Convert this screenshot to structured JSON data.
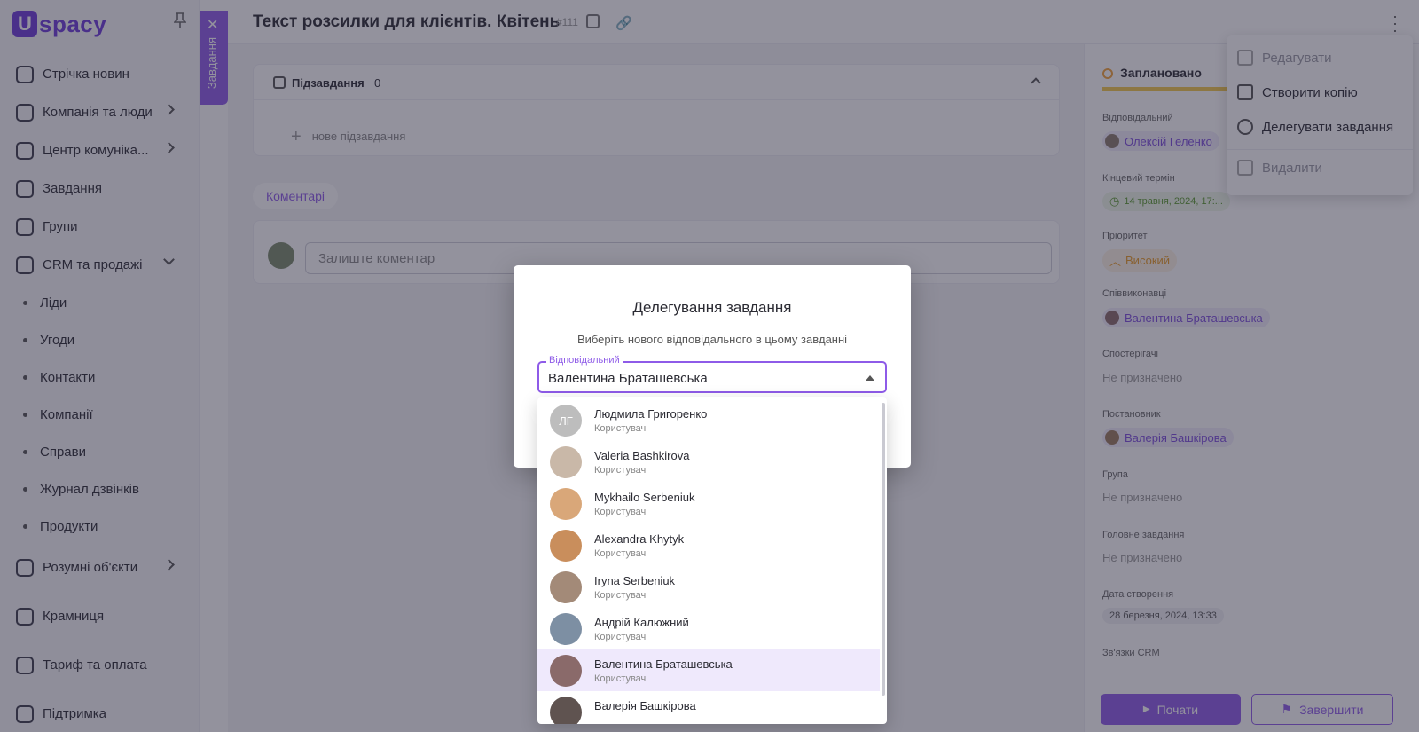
{
  "sidebar": {
    "logo_letter": "U",
    "logo_text": "spacy",
    "items": [
      {
        "label": "Стрічка новин",
        "icon": "home-icon"
      },
      {
        "label": "Компанія та люди",
        "icon": "building-icon",
        "chevron": "right"
      },
      {
        "label": "Центр комуніка...",
        "icon": "chat-icon",
        "chevron": "right"
      },
      {
        "label": "Завдання",
        "icon": "tasks-icon"
      },
      {
        "label": "Групи",
        "icon": "users-icon"
      },
      {
        "label": "CRM та продажі",
        "icon": "crm-icon",
        "chevron": "down"
      }
    ],
    "sub_items": [
      "Ліди",
      "Угоди",
      "Контакти",
      "Компанії",
      "Справи",
      "Журнал дзвінків",
      "Продукти"
    ],
    "bottom_items": [
      {
        "label": "Розумні об'єкти",
        "icon": "smart-objects-icon",
        "chevron": "right"
      },
      {
        "label": "Крамниця",
        "icon": "store-icon"
      },
      {
        "label": "Тариф та оплата",
        "icon": "billing-icon"
      },
      {
        "label": "Підтримка",
        "icon": "help-icon"
      }
    ]
  },
  "side_tab": {
    "label": "Завдання"
  },
  "header": {
    "title": "Текст розсилки для клієнтів. Квітень",
    "task_number": "#111"
  },
  "subtasks": {
    "label": "Підзавдання",
    "count": "0",
    "new_placeholder": "нове підзавдання"
  },
  "comments": {
    "tab_label": "Коментарі",
    "placeholder": "Залиште коментар"
  },
  "right_panel": {
    "status": "Заплановано",
    "fields": [
      {
        "label": "Відповідальний",
        "value": "Олексій Геленко",
        "kind": "person"
      },
      {
        "label": "Кінцевий термін",
        "value": "14 травня, 2024, 17:...",
        "kind": "date"
      },
      {
        "label": "Пріоритет",
        "value": "Високий",
        "kind": "priority"
      },
      {
        "label": "Співвиконавці",
        "value": "Валентина Браташевська",
        "kind": "person"
      },
      {
        "label": "Спостерігачі",
        "value": "Не призначено",
        "kind": "empty"
      },
      {
        "label": "Постановник",
        "value": "Валерія Башкірова",
        "kind": "person"
      },
      {
        "label": "Група",
        "value": "Не призначено",
        "kind": "empty"
      },
      {
        "label": "Головне завдання",
        "value": "Не призначено",
        "kind": "empty"
      },
      {
        "label": "Дата створення",
        "value": "28 березня, 2024, 13:33",
        "kind": "plain"
      },
      {
        "label": "Зв'язки CRM",
        "value": "",
        "kind": "empty"
      }
    ],
    "start_label": "Почати",
    "finish_label": "Завершити"
  },
  "context_menu": {
    "items": [
      {
        "label": "Редагувати",
        "icon": "edit-icon",
        "disabled": true
      },
      {
        "label": "Створити копію",
        "icon": "copy-icon",
        "disabled": false
      },
      {
        "label": "Делегувати завдання",
        "icon": "delegate-user-icon",
        "disabled": false
      },
      {
        "label": "Видалити",
        "icon": "trash-icon",
        "disabled": true
      }
    ]
  },
  "modal": {
    "title": "Делегування завдання",
    "subtitle": "Виберіть нового відповідального в цьому завданні",
    "select_label": "Відповідальний",
    "select_value": "Валентина Браташевська"
  },
  "dropdown": {
    "options": [
      {
        "name": "Людмила Григоренко",
        "role": "Користувач",
        "initials": "ЛГ",
        "color": "#bdbdbd",
        "selected": false
      },
      {
        "name": "Valeria Bashkirova",
        "role": "Користувач",
        "initials": "",
        "color": "#c9b8a8",
        "selected": false
      },
      {
        "name": "Mykhailo Serbeniuk",
        "role": "Користувач",
        "initials": "",
        "color": "#d9a779",
        "selected": false
      },
      {
        "name": "Alexandra Khytyk",
        "role": "Користувач",
        "initials": "",
        "color": "#c98e5c",
        "selected": false
      },
      {
        "name": "Iryna Serbeniuk",
        "role": "Користувач",
        "initials": "",
        "color": "#a38a78",
        "selected": false
      },
      {
        "name": "Андрій Калюжний",
        "role": "Користувач",
        "initials": "",
        "color": "#7d8fa3",
        "selected": false
      },
      {
        "name": "Валентина Браташевська",
        "role": "Користувач",
        "initials": "",
        "color": "#8a6a6a",
        "selected": true
      },
      {
        "name": "Валерія Башкірова",
        "role": "",
        "initials": "",
        "color": "#5f5350",
        "selected": false
      }
    ]
  },
  "colors": {
    "accent": "#8e5be8",
    "overlay": "#28263c"
  }
}
